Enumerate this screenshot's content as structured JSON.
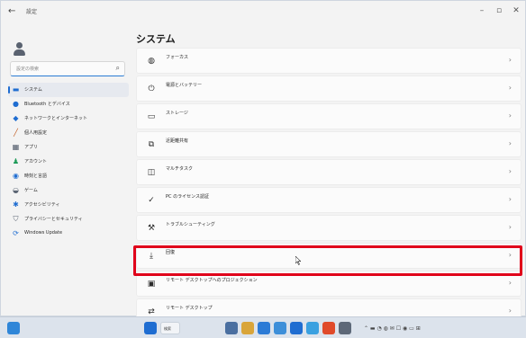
{
  "window": {
    "title": "設定"
  },
  "profile": {
    "name": "",
    "email": ""
  },
  "search": {
    "placeholder": "設定の検索"
  },
  "sidebar": {
    "items": [
      {
        "label": "システム",
        "icon": "monitor-icon",
        "color": "#1f6dd1",
        "active": true
      },
      {
        "label": "Bluetooth とデバイス",
        "icon": "bluetooth-icon",
        "color": "#1f6dd1"
      },
      {
        "label": "ネットワークとインターネット",
        "icon": "wifi-icon",
        "color": "#1f6dd1"
      },
      {
        "label": "個人用設定",
        "icon": "brush-icon",
        "color": "#c05a1e"
      },
      {
        "label": "アプリ",
        "icon": "apps-icon",
        "color": "#4b5565"
      },
      {
        "label": "アカウント",
        "icon": "person-icon",
        "color": "#1d9a58"
      },
      {
        "label": "時刻と言語",
        "icon": "globe-clock-icon",
        "color": "#1f6dd1"
      },
      {
        "label": "ゲーム",
        "icon": "gamepad-icon",
        "color": "#5b6573"
      },
      {
        "label": "アクセシビリティ",
        "icon": "accessibility-icon",
        "color": "#1f6dd1"
      },
      {
        "label": "プライバシーとセキュリティ",
        "icon": "shield-icon",
        "color": "#5b6573"
      },
      {
        "label": "Windows Update",
        "icon": "update-icon",
        "color": "#1f6dd1"
      }
    ]
  },
  "main": {
    "title": "システム",
    "rows": [
      {
        "title": "フォーカス",
        "desc": "",
        "icon": "focus-icon"
      },
      {
        "title": "電源とバッテリー",
        "desc": "",
        "icon": "power-icon"
      },
      {
        "title": "ストレージ",
        "desc": "",
        "icon": "storage-icon"
      },
      {
        "title": "近距離共有",
        "desc": "",
        "icon": "nearby-share-icon"
      },
      {
        "title": "マルチタスク",
        "desc": "",
        "icon": "multitasking-icon"
      },
      {
        "title": "PC のライセンス認証",
        "desc": "",
        "icon": "activation-icon"
      },
      {
        "title": "トラブルシューティング",
        "desc": "",
        "icon": "troubleshoot-icon"
      },
      {
        "title": "回復",
        "desc": "",
        "icon": "recovery-icon"
      },
      {
        "title": "リモート デスクトップへのプロジェクション",
        "desc": "",
        "icon": "projection-icon"
      },
      {
        "title": "リモート デスクトップ",
        "desc": "",
        "icon": "remote-desktop-icon"
      }
    ]
  },
  "taskbar": {
    "search_label": "検索",
    "time": "",
    "date": ""
  },
  "colors": {
    "accent": "#1f6dd1",
    "highlight": "#e0001a"
  }
}
